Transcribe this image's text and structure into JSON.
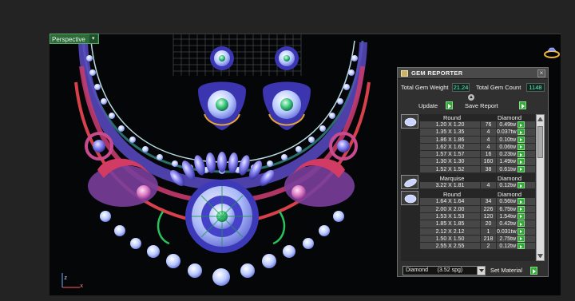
{
  "viewport": {
    "view_mode": "Perspective",
    "axis_labels": {
      "z": "z",
      "x": "x"
    }
  },
  "gem_reporter": {
    "title": "GEM REPORTER",
    "total_gem_weight_label": "Total Gem Weight",
    "total_gem_weight": "21.24",
    "total_gem_count_label": "Total Gem Count",
    "total_gem_count": "1148",
    "update_label": "Update",
    "save_report_label": "Save Report",
    "groups": [
      {
        "shape": "Round",
        "material": "Diamond",
        "rows": [
          {
            "size": "1.20 X 1.20",
            "count": "76",
            "weight": "0.49tw"
          },
          {
            "size": "1.35 X 1.35",
            "count": "4",
            "weight": "0.037tw"
          },
          {
            "size": "1.86 X 1.86",
            "count": "4",
            "weight": "0.10tw"
          },
          {
            "size": "1.62 X 1.62",
            "count": "4",
            "weight": "0.06tw"
          },
          {
            "size": "1.57 X 1.57",
            "count": "16",
            "weight": "0.23tw"
          },
          {
            "size": "1.30 X 1.30",
            "count": "160",
            "weight": "1.49tw"
          },
          {
            "size": "1.52 X 1.52",
            "count": "38",
            "weight": "0.61tw"
          }
        ]
      },
      {
        "shape": "Marquise",
        "material": "Diamond",
        "rows": [
          {
            "size": "3.22 X 1.81",
            "count": "4",
            "weight": "0.12tw"
          }
        ]
      },
      {
        "shape": "Round",
        "material": "Diamond",
        "rows": [
          {
            "size": "1.64 X 1.64",
            "count": "34",
            "weight": "0.56tw"
          },
          {
            "size": "2.00 X 2.00",
            "count": "226",
            "weight": "6.75tw"
          },
          {
            "size": "1.53 X 1.53",
            "count": "120",
            "weight": "1.54tw"
          },
          {
            "size": "1.85 X 1.85",
            "count": "20",
            "weight": "0.42tw"
          },
          {
            "size": "2.12 X 2.12",
            "count": "1",
            "weight": "0.031tw"
          },
          {
            "size": "1.50 X 1.50",
            "count": "218",
            "weight": "2.75tw"
          },
          {
            "size": "2.55 X 2.55",
            "count": "2",
            "weight": "0.12tw"
          }
        ]
      }
    ],
    "material_select": "Diamond      (3.52 spg)",
    "set_material_label": "Set Material"
  },
  "colors": {
    "accent_green": "#35a83a",
    "readout_teal": "#7ee6c8",
    "panel_bg": "#303030",
    "viewport_bg": "#050608"
  }
}
